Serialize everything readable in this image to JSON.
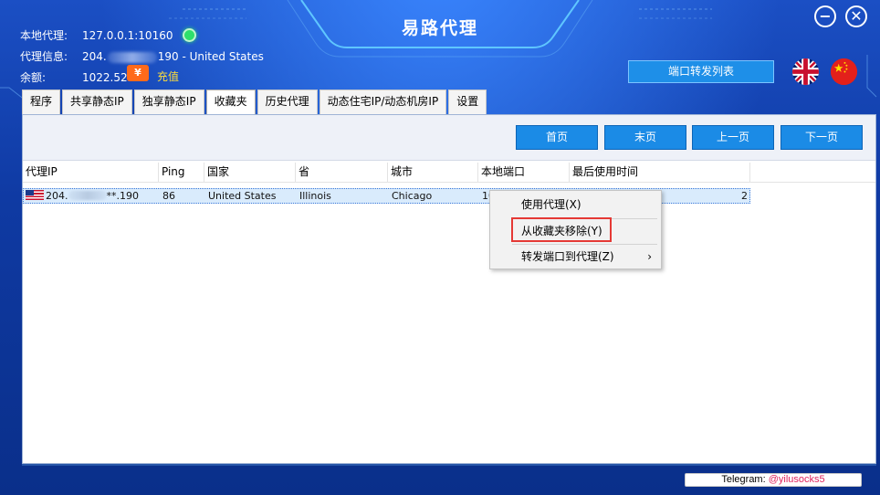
{
  "app": {
    "title": "易路代理"
  },
  "info": {
    "local_label": "本地代理:",
    "local_value": "127.0.0.1:10160",
    "proxy_label": "代理信息:",
    "proxy_prefix": "204.",
    "proxy_suffix": "190 - United States",
    "balance_label": "余额:",
    "balance_value": "1022.52",
    "recharge_icon": "¥",
    "recharge_label": "充值"
  },
  "header": {
    "port_forward_list": "端口转发列表",
    "minimize": "−",
    "close": "✕"
  },
  "tabs": [
    {
      "label": "程序"
    },
    {
      "label": "共享静态IP"
    },
    {
      "label": "独享静态IP"
    },
    {
      "label": "收藏夹"
    },
    {
      "label": "历史代理"
    },
    {
      "label": "动态住宅IP/动态机房IP"
    },
    {
      "label": "设置"
    }
  ],
  "pager": {
    "first": "首页",
    "last": "末页",
    "prev": "上一页",
    "next": "下一页"
  },
  "table": {
    "columns": [
      "代理IP",
      "Ping",
      "国家",
      "省",
      "城市",
      "本地端口",
      "最后使用时间"
    ],
    "rows": [
      {
        "ip_prefix": "204.",
        "ip_suffix": "**.190",
        "ping": "86",
        "country": "United States",
        "province": "Illinois",
        "city": "Chicago",
        "port": "10",
        "time": "2"
      }
    ]
  },
  "context_menu": {
    "use_proxy": "使用代理(X)",
    "remove_favorite": "从收藏夹移除(Y)",
    "forward_port": "转发端口到代理(Z)",
    "submenu_arrow": "›"
  },
  "footer": {
    "telegram_label": "Telegram: ",
    "telegram_handle": "@yilusocks5"
  },
  "colors": {
    "accent": "#1b8be6",
    "online": "#2ee06b",
    "recharge": "#ffde3a",
    "highlight": "#e53935"
  }
}
